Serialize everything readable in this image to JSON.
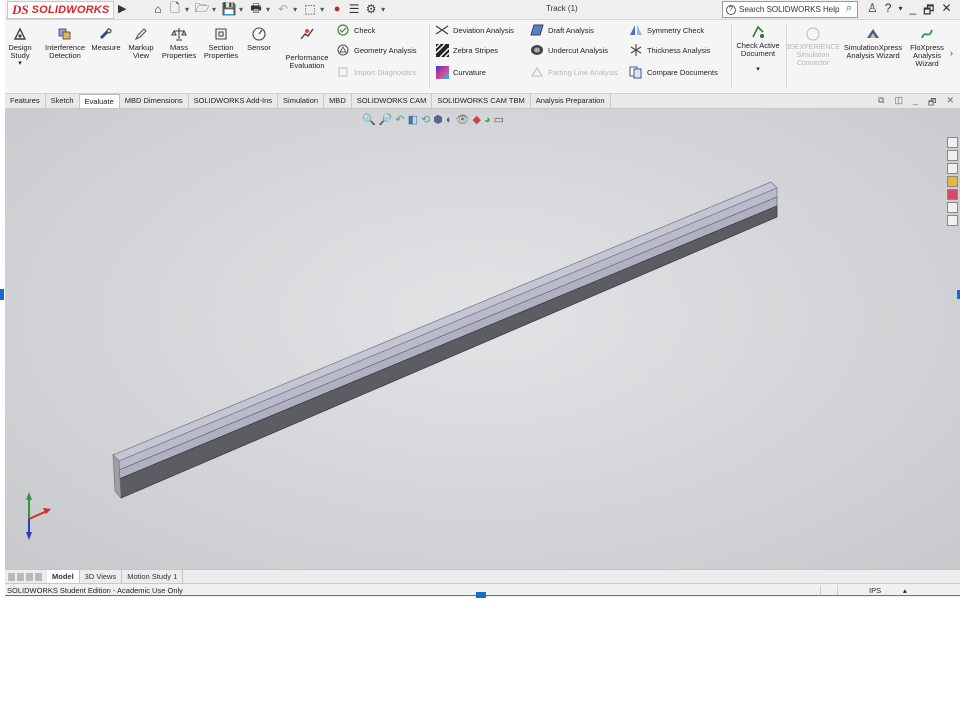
{
  "app": {
    "logo_ds": "DS",
    "logo_text": "SOLIDWORKS",
    "document_title": "Track (1)",
    "help_placeholder": "Search SOLIDWORKS Help"
  },
  "ribbon": {
    "design_study": "Design Study",
    "interference_detection": "Interference Detection",
    "measure": "Measure",
    "markup_view": "Markup View",
    "mass_properties": "Mass Properties",
    "section_properties": "Section Properties",
    "sensor": "Sensor",
    "performance_evaluation": "Performance Evaluation",
    "check": "Check",
    "geometry_analysis": "Geometry Analysis",
    "import_diagnostics": "Import Diagnostics",
    "deviation_analysis": "Deviation Analysis",
    "zebra_stripes": "Zebra Stripes",
    "curvature": "Curvature",
    "draft_analysis": "Draft Analysis",
    "undercut_analysis": "Undercut Analysis",
    "parting_line_analysis": "Parting Line Analysis",
    "symmetry_check": "Symmetry Check",
    "thickness_analysis": "Thickness Analysis",
    "compare_documents": "Compare Documents",
    "check_active_document": "Check Active Document",
    "experience_connector": "3DEXPERIENCE Simulation Connector",
    "simulationxpress": "SimulationXpress Analysis Wizard",
    "floxpress": "FloXpress Analysis Wizard"
  },
  "tabs": [
    {
      "label": "Features"
    },
    {
      "label": "Sketch"
    },
    {
      "label": "Evaluate"
    },
    {
      "label": "MBD Dimensions"
    },
    {
      "label": "SOLIDWORKS Add-Ins"
    },
    {
      "label": "Simulation"
    },
    {
      "label": "MBD"
    },
    {
      "label": "SOLIDWORKS CAM"
    },
    {
      "label": "SOLIDWORKS CAM TBM"
    },
    {
      "label": "Analysis Preparation"
    }
  ],
  "active_tab": "Evaluate",
  "bottom_tabs": [
    {
      "label": "Model"
    },
    {
      "label": "3D Views"
    },
    {
      "label": "Motion Study 1"
    }
  ],
  "status": {
    "edition": "SOLIDWORKS Student Edition - Academic Use Only",
    "units": "IPS"
  },
  "colors": {
    "brand_red": "#d8262c",
    "viewport_bg": "#cfd1d4",
    "part_top": "#b7b9c9",
    "part_side": "#55575c",
    "selection_blue": "#1b6ac9"
  }
}
